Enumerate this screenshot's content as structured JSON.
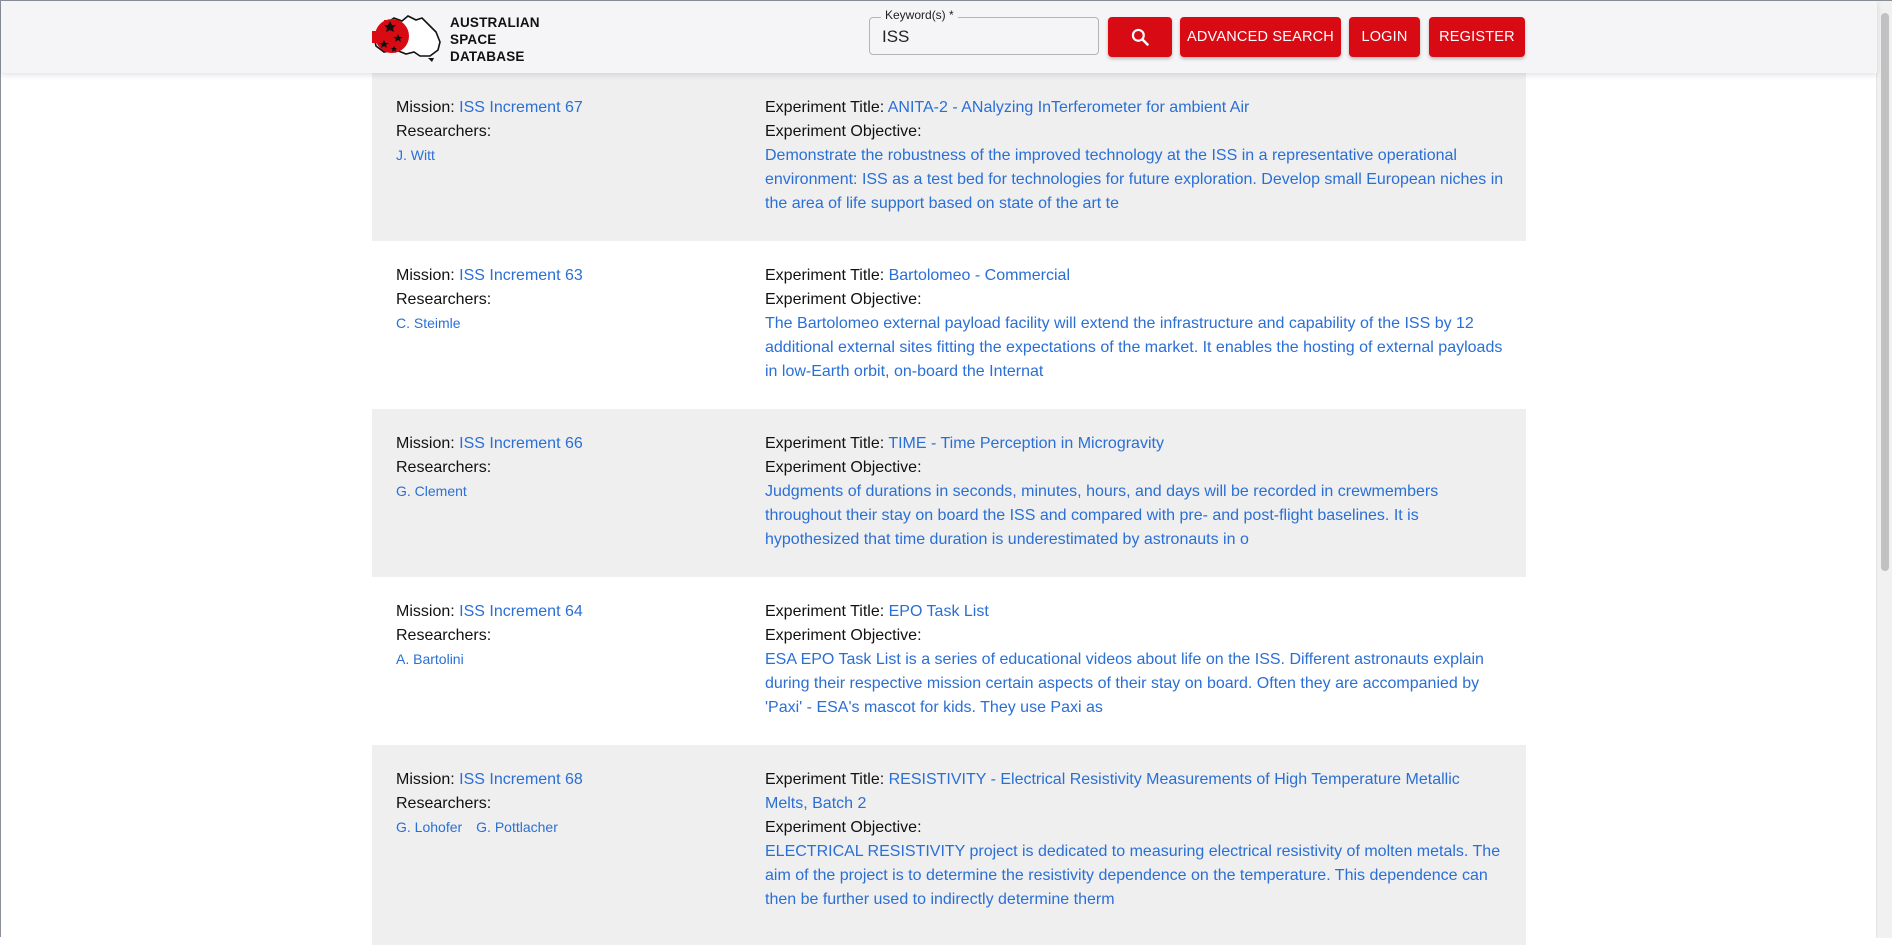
{
  "header": {
    "logo_lines": [
      "AUSTRALIAN",
      "SPACE",
      "DATABASE"
    ],
    "keyword_label": "Keyword(s) *",
    "keyword_value": "ISS",
    "search_icon": "search-icon",
    "advanced_search_label": "ADVANCED SEARCH",
    "login_label": "LOGIN",
    "register_label": "REGISTER",
    "brand_color": "#d80a13"
  },
  "labels": {
    "mission": "Mission:",
    "researchers": "Researchers:",
    "experiment_title": "Experiment Title:",
    "experiment_objective": "Experiment Objective:"
  },
  "results": [
    {
      "mission": "ISS Increment 67",
      "researchers": [
        "J. Witt"
      ],
      "title": "ANITA-2 - ANalyzing InTerferometer for ambient Air",
      "objective": "Demonstrate the robustness of the improved technology at the ISS in a representative operational environment: ISS as a test bed for technologies for future exploration. Develop small European niches in the area of life support based on state of the art te"
    },
    {
      "mission": "ISS Increment 63",
      "researchers": [
        "C. Steimle"
      ],
      "title": "Bartolomeo - Commercial",
      "objective": "The Bartolomeo external payload facility will extend the infrastructure and capability of the ISS by 12 additional external sites fitting the expectations of the market. It enables the hosting of external payloads in low-Earth orbit, on-board the Internat"
    },
    {
      "mission": "ISS Increment 66",
      "researchers": [
        "G. Clement"
      ],
      "title": "TIME - Time Perception in Microgravity",
      "objective": "Judgments of durations in seconds, minutes, hours, and days will be recorded in crewmembers throughout their stay on board the ISS and compared with pre- and post-flight baselines. It is hypothesized that time duration is underestimated by astronauts in o"
    },
    {
      "mission": "ISS Increment 64",
      "researchers": [
        "A. Bartolini"
      ],
      "title": "EPO Task List",
      "objective": "ESA EPO Task List is a series of educational videos about life on the ISS. Different astronauts explain during their respective mission certain aspects of their stay on board. Often they are accompanied by 'Paxi' - ESA's mascot for kids. They use Paxi as"
    },
    {
      "mission": "ISS Increment 68",
      "researchers": [
        "G. Lohofer",
        "G. Pottlacher"
      ],
      "title": "RESISTIVITY - Electrical Resistivity Measurements of High Temperature Metallic Melts, Batch 2",
      "objective": "ELECTRICAL RESISTIVITY project is dedicated to measuring electrical resistivity of molten metals. The aim of the project is to determine the resistivity dependence on the temperature. This dependence can then be further used to indirectly determine therm"
    }
  ]
}
